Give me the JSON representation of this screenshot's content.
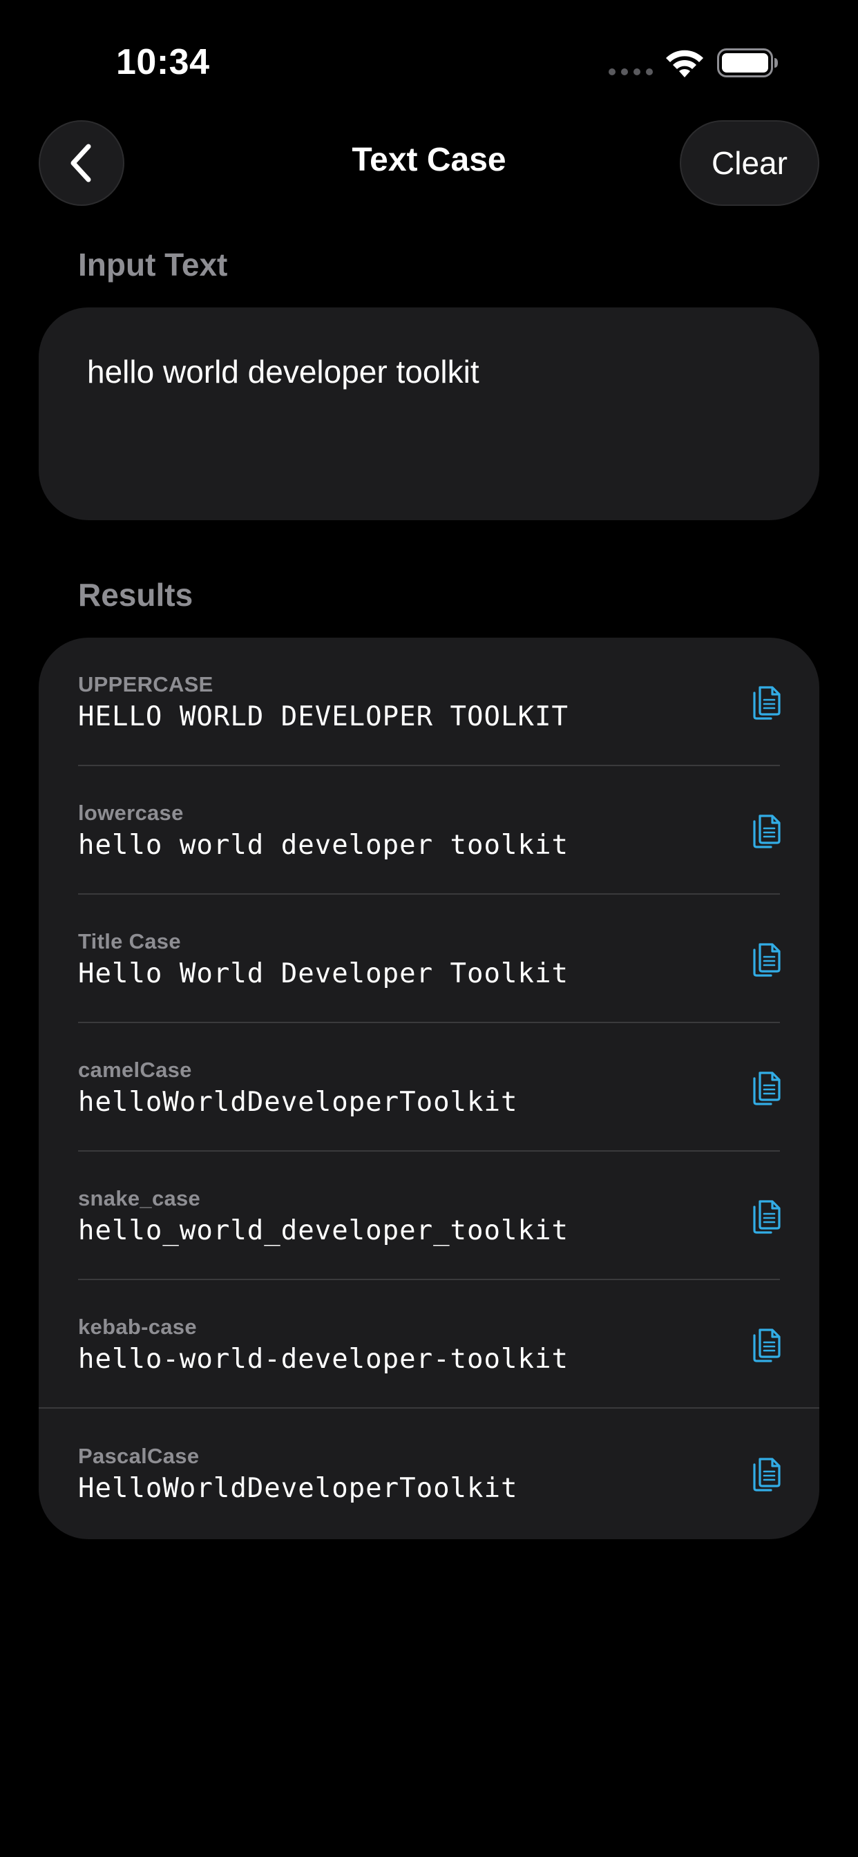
{
  "status_bar": {
    "time": "10:34"
  },
  "nav": {
    "title": "Text Case",
    "clear_label": "Clear"
  },
  "input": {
    "section_label": "Input Text",
    "value": "hello world developer toolkit"
  },
  "results": {
    "section_label": "Results",
    "items": [
      {
        "label": "UPPERCASE",
        "value": "HELLO WORLD DEVELOPER TOOLKIT"
      },
      {
        "label": "lowercase",
        "value": "hello world developer toolkit"
      },
      {
        "label": "Title Case",
        "value": "Hello World Developer Toolkit"
      },
      {
        "label": "camelCase",
        "value": "helloWorldDeveloperToolkit"
      },
      {
        "label": "snake_case",
        "value": "hello_world_developer_toolkit"
      },
      {
        "label": "kebab-case",
        "value": "hello-world-developer-toolkit"
      },
      {
        "label": "PascalCase",
        "value": "HelloWorldDeveloperToolkit"
      }
    ]
  },
  "colors": {
    "background": "#000000",
    "card": "#1c1c1e",
    "secondary_text": "#8e8e93",
    "accent": "#32ade6",
    "divider": "#3a3a3c"
  },
  "icons": {
    "back": "chevron-left-icon",
    "copy": "copy-icon",
    "wifi": "wifi-icon",
    "battery": "battery-icon",
    "signal": "signal-dots-icon"
  }
}
